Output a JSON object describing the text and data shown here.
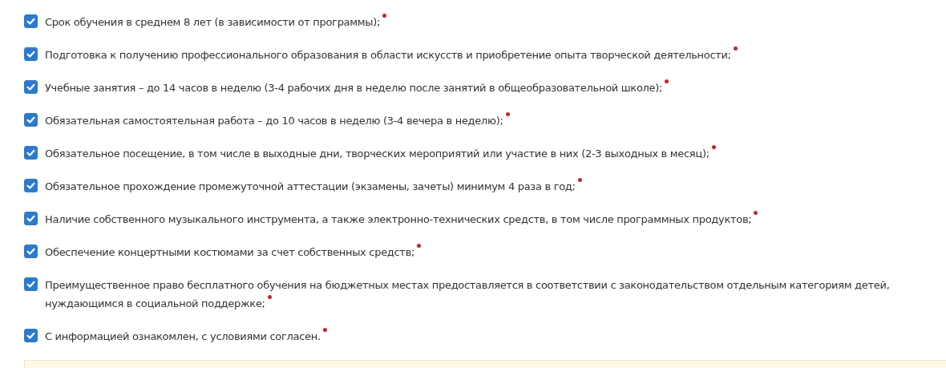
{
  "items": [
    {
      "label": "Срок обучения в среднем 8 лет (в зависимости от программы);",
      "checked": true,
      "required": true
    },
    {
      "label": "Подготовка к получению профессионального образования в области искусств и приобретение опыта творческой деятельности;",
      "checked": true,
      "required": true
    },
    {
      "label": "Учебные занятия – до 14 часов в неделю (3-4 рабочих дня в неделю после занятий в общеобразовательной школе);",
      "checked": true,
      "required": true
    },
    {
      "label": "Обязательная самостоятельная работа – до 10 часов в неделю (3-4 вечера в неделю);",
      "checked": true,
      "required": true
    },
    {
      "label": "Обязательное посещение, в том числе в выходные дни, творческих мероприятий или участие в них (2-3 выходных в месяц);",
      "checked": true,
      "required": true
    },
    {
      "label": "Обязательное прохождение промежуточной аттестации (экзамены, зачеты) минимум 4 раза в год;",
      "checked": true,
      "required": true
    },
    {
      "label": "Наличие собственного музыкального инструмента, а также электронно-технических средств, в том числе программных продуктов;",
      "checked": true,
      "required": true
    },
    {
      "label": "Обеспечение концертными костюмами за счет собственных средств;",
      "checked": true,
      "required": true
    },
    {
      "label": "Преимущественное право бесплатного обучения на бюджетных местах предоставляется в соответствии с законодательством отдельным категориям детей, нуждающимся в социальной поддержке;",
      "checked": true,
      "required": true
    },
    {
      "label": "С информацией ознакомлен, с условиями согласен.",
      "checked": true,
      "required": true
    }
  ]
}
